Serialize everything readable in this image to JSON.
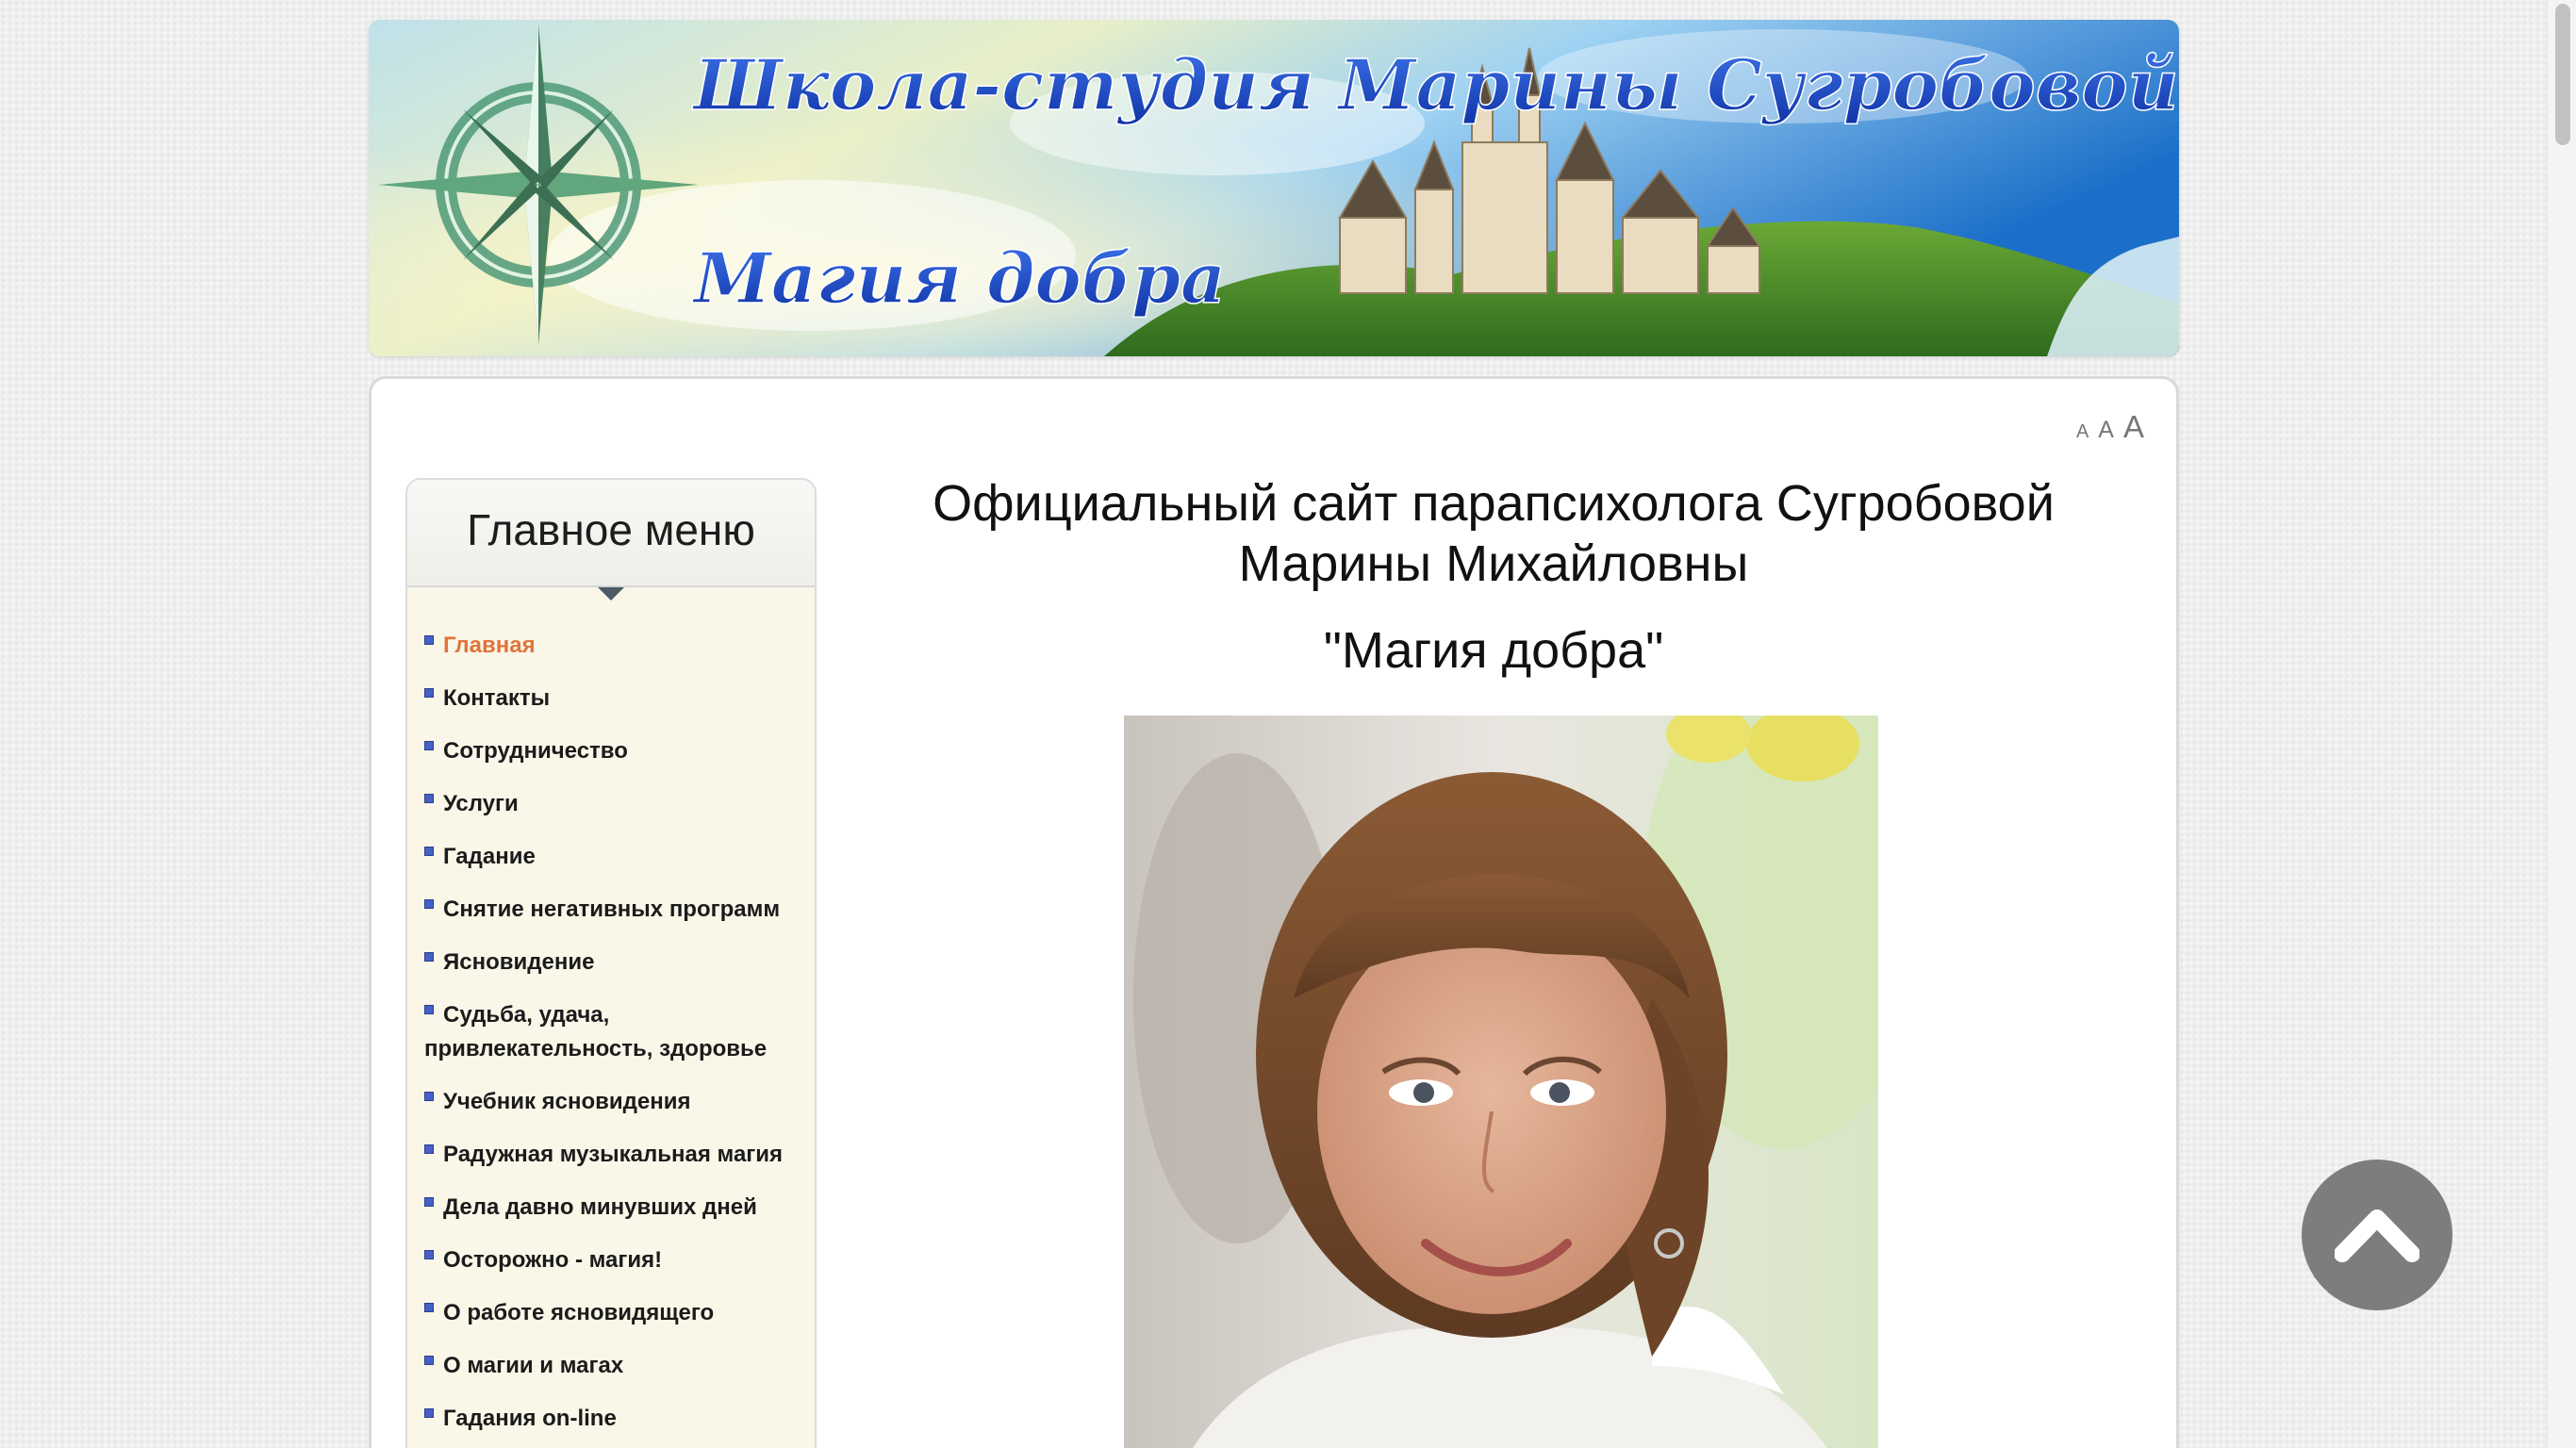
{
  "banner": {
    "title": "Школа-студия Марины Сугробовой",
    "subtitle": "Магия добра"
  },
  "font_size_controls": {
    "small": "A",
    "medium": "A",
    "large": "A"
  },
  "sidebar": {
    "title": "Главное меню",
    "items": [
      {
        "label": "Главная",
        "active": true
      },
      {
        "label": "Контакты"
      },
      {
        "label": "Сотрудничество"
      },
      {
        "label": "Услуги"
      },
      {
        "label": "Гадание"
      },
      {
        "label": "Снятие негативных программ"
      },
      {
        "label": "Ясновидение"
      },
      {
        "label": "Судьба, удача, привлекательность, здоровье"
      },
      {
        "label": "Учебник ясновидения"
      },
      {
        "label": "Радужная музыкальная магия"
      },
      {
        "label": "Дела давно минувших дней"
      },
      {
        "label": "Осторожно - магия!"
      },
      {
        "label": "О работе ясновидящего"
      },
      {
        "label": "О магии и магах"
      },
      {
        "label": "Гадания on-line"
      }
    ]
  },
  "main": {
    "title": "Официальный сайт парапсихолога Сугробовой Марины Михайловны",
    "subtitle": "\"Магия добра\""
  },
  "colors": {
    "active_menu": "#e0743c",
    "banner_text": "#1f4fc4",
    "bullet": "#4760c8",
    "back_to_top": "#7d7d7d"
  },
  "icons": {
    "back_to_top": "chevron-up-icon",
    "menu_bullet": "square-bullet-icon",
    "banner_compass": "compass-rose-icon"
  }
}
